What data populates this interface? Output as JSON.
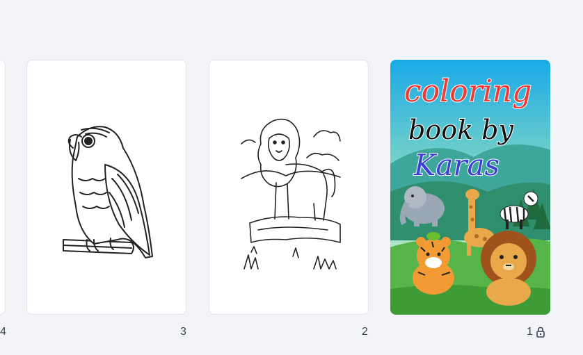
{
  "pages": [
    {
      "number": "4",
      "kind": "partial"
    },
    {
      "number": "3",
      "illustration": "parrot"
    },
    {
      "number": "2",
      "illustration": "lion"
    },
    {
      "number": "1",
      "illustration": "cover",
      "locked": true
    }
  ],
  "cover": {
    "line1": "coloring",
    "line2": "book by",
    "line3": "Karas",
    "colors": {
      "line1": "#ef3b36",
      "line2": "#111111",
      "line3": "#3a3fd6"
    }
  },
  "icons": {
    "lock": "lock-icon"
  }
}
